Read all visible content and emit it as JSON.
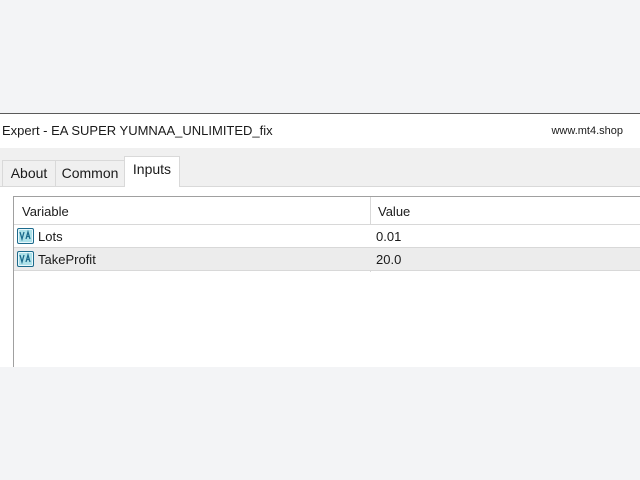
{
  "window": {
    "title": "Expert - EA SUPER YUMNAA_UNLIMITED_fix",
    "watermark": "www.mt4.shop"
  },
  "tabs": [
    {
      "label": "About",
      "selected": false
    },
    {
      "label": "Common",
      "selected": false
    },
    {
      "label": "Inputs",
      "selected": true
    }
  ],
  "grid": {
    "columns": [
      "Variable",
      "Value"
    ],
    "rows": [
      {
        "variable": "Lots",
        "value": "0.01",
        "icon": "va-variable-icon"
      },
      {
        "variable": "TakeProfit",
        "value": "20.0",
        "icon": "va-variable-icon"
      }
    ]
  },
  "colors": {
    "icon_teal": "#3fb6c9",
    "icon_dark": "#1c6a8c",
    "selected_row": "#ececec"
  }
}
